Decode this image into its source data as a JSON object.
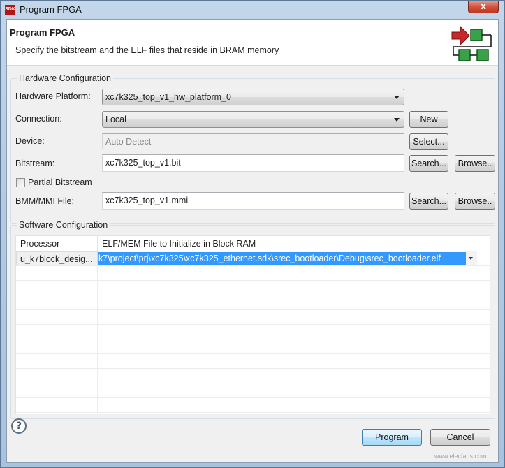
{
  "window": {
    "app_icon_text": "SDK",
    "title": "Program FPGA",
    "close_label": "x"
  },
  "header": {
    "title": "Program FPGA",
    "description": "Specify the bitstream and the ELF files that reside in BRAM memory"
  },
  "hardware": {
    "group_title": "Hardware Configuration",
    "platform_label": "Hardware Platform:",
    "platform_value": "xc7k325_top_v1_hw_platform_0",
    "connection_label": "Connection:",
    "connection_value": "Local",
    "new_button": "New",
    "device_label": "Device:",
    "device_value": "Auto Detect",
    "select_button": "Select...",
    "bitstream_label": "Bitstream:",
    "bitstream_value": "xc7k325_top_v1.bit",
    "bitstream_search": "Search...",
    "bitstream_browse": "Browse..",
    "partial_label": "Partial Bitstream",
    "partial_checked": false,
    "bmm_label": "BMM/MMI File:",
    "bmm_value": "xc7k325_top_v1.mmi",
    "bmm_search": "Search...",
    "bmm_browse": "Browse.."
  },
  "software": {
    "group_title": "Software Configuration",
    "columns": [
      "Processor",
      "ELF/MEM File to Initialize in Block RAM"
    ],
    "rows": [
      {
        "processor": "u_k7block_desig...",
        "elf": "k7\\project\\prj\\xc7k325\\xc7k325_ethernet.sdk\\srec_bootloader\\Debug\\srec_bootloader.elf"
      }
    ]
  },
  "footer": {
    "help_icon": "?",
    "program_button": "Program",
    "cancel_button": "Cancel"
  },
  "watermark": {
    "text": "www.elecfans.com"
  }
}
